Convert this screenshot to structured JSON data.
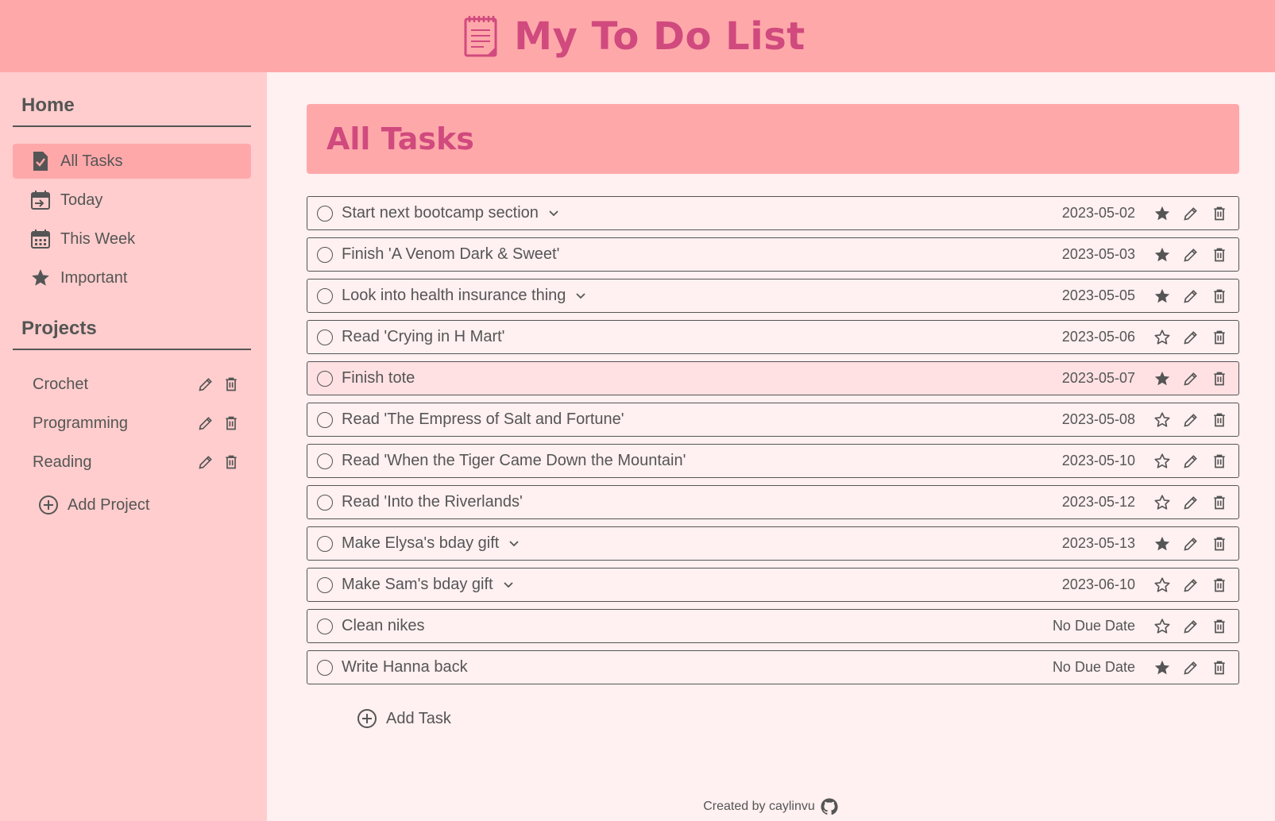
{
  "app": {
    "title": "My To Do List",
    "accent_color": "#d04a7e",
    "header_color": "#ffa8aa",
    "sidebar_color": "#ffcdcd",
    "background_color": "#fff0f1"
  },
  "sidebar": {
    "home_heading": "Home",
    "nav": [
      {
        "label": "All Tasks",
        "icon": "task-check-icon",
        "active": true
      },
      {
        "label": "Today",
        "icon": "calendar-today-icon",
        "active": false
      },
      {
        "label": "This Week",
        "icon": "calendar-week-icon",
        "active": false
      },
      {
        "label": "Important",
        "icon": "star-icon",
        "active": false
      }
    ],
    "projects_heading": "Projects",
    "projects": [
      {
        "name": "Crochet"
      },
      {
        "name": "Programming"
      },
      {
        "name": "Reading"
      }
    ],
    "add_project_label": "Add Project"
  },
  "main": {
    "title": "All Tasks",
    "tasks": [
      {
        "name": "Start next bootcamp section",
        "date": "2023-05-02",
        "important": true,
        "expandable": true,
        "highlight": false
      },
      {
        "name": "Finish 'A Venom Dark & Sweet'",
        "date": "2023-05-03",
        "important": true,
        "expandable": false,
        "highlight": false
      },
      {
        "name": "Look into health insurance thing",
        "date": "2023-05-05",
        "important": true,
        "expandable": true,
        "highlight": false
      },
      {
        "name": "Read 'Crying in H Mart'",
        "date": "2023-05-06",
        "important": false,
        "expandable": false,
        "highlight": false
      },
      {
        "name": "Finish tote",
        "date": "2023-05-07",
        "important": true,
        "expandable": false,
        "highlight": true
      },
      {
        "name": "Read 'The Empress of Salt and Fortune'",
        "date": "2023-05-08",
        "important": false,
        "expandable": false,
        "highlight": false
      },
      {
        "name": "Read 'When the Tiger Came Down the Mountain'",
        "date": "2023-05-10",
        "important": false,
        "expandable": false,
        "highlight": false
      },
      {
        "name": "Read 'Into the Riverlands'",
        "date": "2023-05-12",
        "important": false,
        "expandable": false,
        "highlight": false
      },
      {
        "name": "Make Elysa's bday gift",
        "date": "2023-05-13",
        "important": true,
        "expandable": true,
        "highlight": false
      },
      {
        "name": "Make Sam's bday gift",
        "date": "2023-06-10",
        "important": false,
        "expandable": true,
        "highlight": false
      },
      {
        "name": "Clean nikes",
        "date": "No Due Date",
        "important": false,
        "expandable": false,
        "highlight": false
      },
      {
        "name": "Write Hanna back",
        "date": "No Due Date",
        "important": true,
        "expandable": false,
        "highlight": false
      }
    ],
    "add_task_label": "Add Task"
  },
  "footer": {
    "text": "Created by caylinvu",
    "icon": "github-icon"
  }
}
